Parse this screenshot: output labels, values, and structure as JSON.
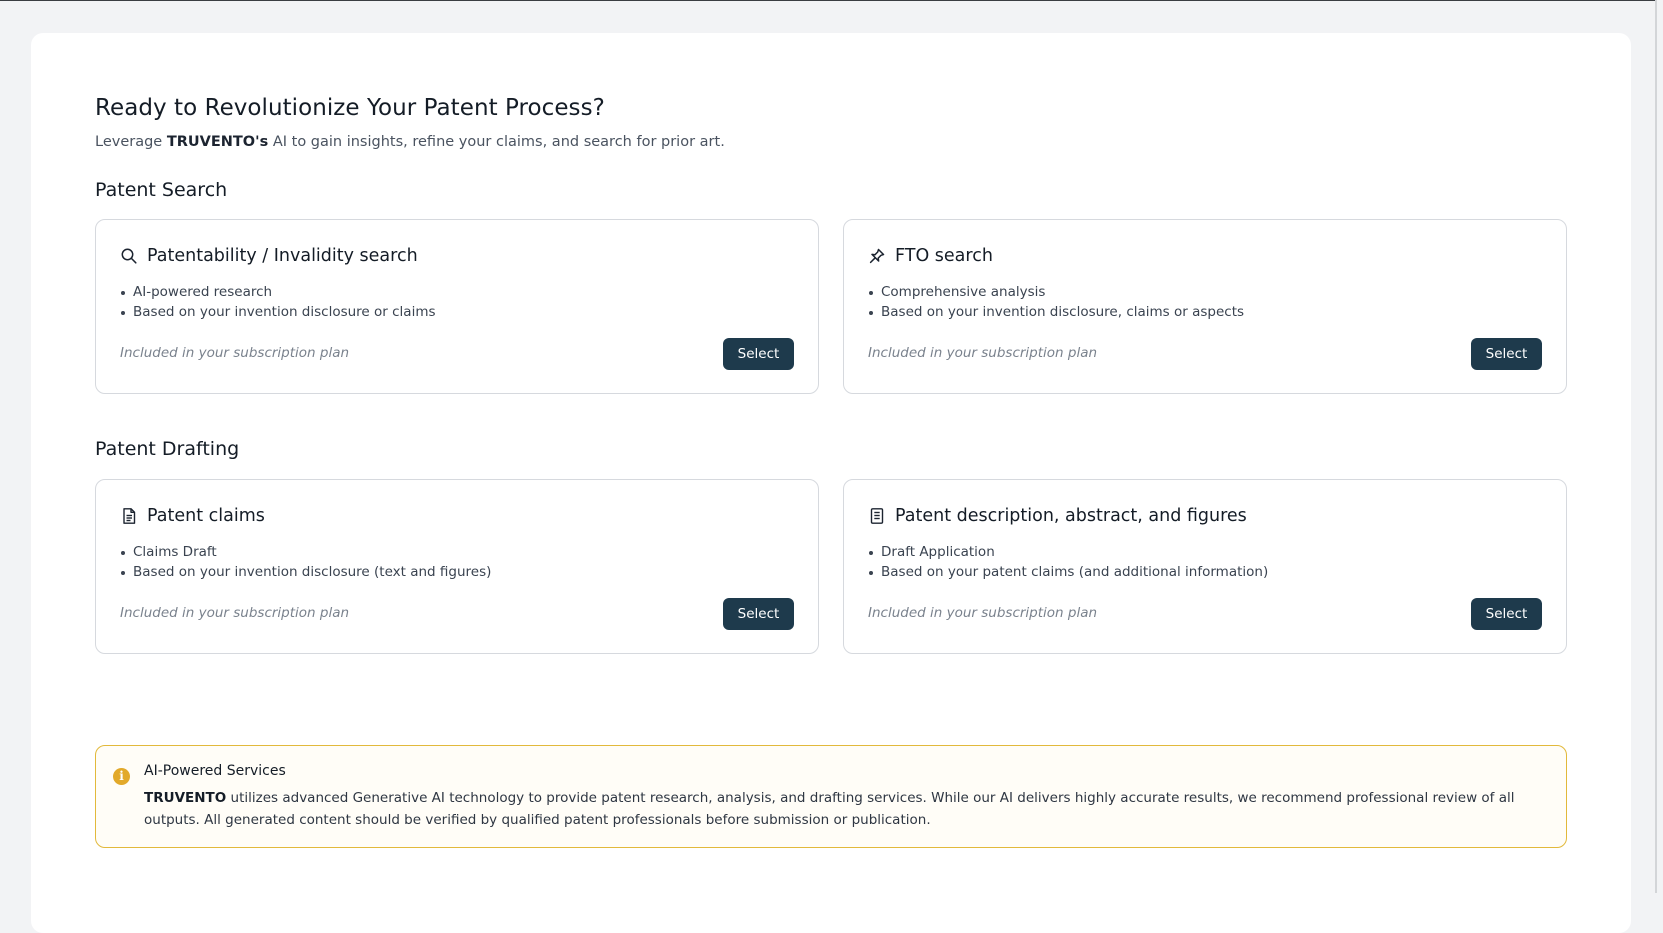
{
  "header": {
    "title": "Ready to Revolutionize Your Patent Process?",
    "subtitle_prefix": "Leverage",
    "brand": "TRUVENTO's",
    "subtitle_suffix": "AI to gain insights, refine your claims, and search for prior art."
  },
  "sections": {
    "search": {
      "title": "Patent Search",
      "cards": [
        {
          "title": "Patentability / Invalidity search",
          "icon": "search-icon",
          "bullets": [
            "AI-powered research",
            "Based on your invention disclosure or claims"
          ],
          "note": "Included in your subscription plan",
          "button": "Select"
        },
        {
          "title": "FTO search",
          "icon": "pin-icon",
          "bullets": [
            "Comprehensive analysis",
            "Based on your invention disclosure, claims or aspects"
          ],
          "note": "Included in your subscription plan",
          "button": "Select"
        }
      ]
    },
    "drafting": {
      "title": "Patent Drafting",
      "cards": [
        {
          "title": "Patent claims",
          "icon": "document-icon",
          "bullets": [
            "Claims Draft",
            "Based on your invention disclosure (text and figures)"
          ],
          "note": "Included in your subscription plan",
          "button": "Select"
        },
        {
          "title": "Patent description, abstract, and figures",
          "icon": "document-icon",
          "bullets": [
            "Draft Application",
            "Based on your patent claims (and additional information)"
          ],
          "note": "Included in your subscription plan",
          "button": "Select"
        }
      ]
    }
  },
  "notice": {
    "icon": "info-icon",
    "title": "AI-Powered Services",
    "brand": "TRUVENTO",
    "text": "utilizes advanced Generative AI technology to provide patent research, analysis, and drafting services. While our AI delivers highly accurate results, we recommend professional review of all outputs. All generated content should be verified by qualified patent professionals before submission or publication."
  },
  "colors": {
    "button_bg": "#1e3a4c",
    "notice_border": "#e2b93b",
    "info_icon": "#e2a92a"
  }
}
